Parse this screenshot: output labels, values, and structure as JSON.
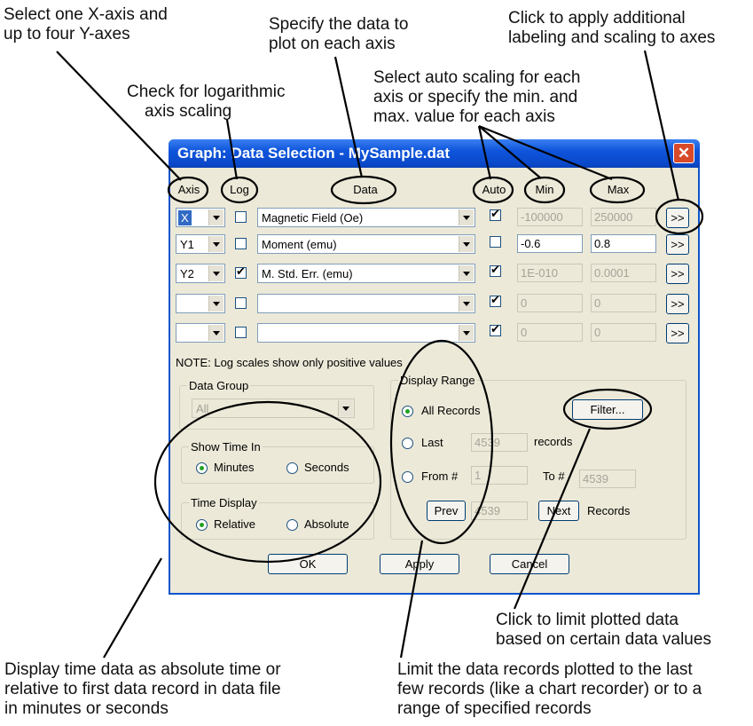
{
  "annotations": {
    "axes_select": [
      "Select one X-axis and",
      "up to four Y-axes"
    ],
    "specify_data": [
      "Specify the data to",
      "plot on each axis"
    ],
    "labeling": [
      "Click to apply additional",
      "labeling and scaling to axes"
    ],
    "log_scaling": [
      "Check for logarithmic",
      "axis scaling"
    ],
    "auto_scaling": [
      "Select auto scaling for each",
      "axis or specify the min. and",
      "max. value for each axis"
    ],
    "filter": [
      "Click to limit plotted data",
      "based on certain data values"
    ],
    "time_display": [
      "Display time data as absolute time or",
      "relative to first data record in data file",
      "in minutes or seconds"
    ],
    "limit_records": [
      "Limit the data records plotted to the last",
      "few records (like a chart recorder) or to a",
      "range of specified records"
    ]
  },
  "dialog": {
    "title": "Graph: Data Selection - MySample.dat",
    "close_glyph": "✕",
    "headers": {
      "axis": "Axis",
      "log": "Log",
      "data": "Data",
      "auto": "Auto",
      "min": "Min",
      "max": "Max"
    },
    "rows": [
      {
        "axis": "X",
        "log": false,
        "data": "Magnetic Field (Oe)",
        "auto": true,
        "min": "-100000",
        "max": "250000",
        "more": ">>"
      },
      {
        "axis": "Y1",
        "log": false,
        "data": "Moment (emu)",
        "auto": false,
        "min": "-0.6",
        "max": "0.8",
        "more": ">>"
      },
      {
        "axis": "Y2",
        "log": true,
        "data": "M. Std. Err. (emu)",
        "auto": true,
        "min": "1E-010",
        "max": "0.0001",
        "more": ">>"
      },
      {
        "axis": "",
        "log": false,
        "data": "",
        "auto": true,
        "min": "0",
        "max": "0",
        "more": ">>"
      },
      {
        "axis": "",
        "log": false,
        "data": "",
        "auto": true,
        "min": "0",
        "max": "0",
        "more": ">>"
      }
    ],
    "note": "NOTE: Log scales show only positive values",
    "data_group": {
      "label": "Data Group",
      "value": "All"
    },
    "show_time": {
      "label": "Show Time In",
      "minutes": "Minutes",
      "seconds": "Seconds",
      "selected": "minutes"
    },
    "time_display": {
      "label": "Time Display",
      "relative": "Relative",
      "absolute": "Absolute",
      "selected": "relative"
    },
    "display_range": {
      "label": "Display Range",
      "all_records": "All Records",
      "last": "Last",
      "last_value": "4539",
      "records": "records",
      "from": "From #",
      "from_value": "1",
      "to": "To #",
      "to_value": "4539",
      "prev": "Prev",
      "page_value": "4539",
      "next": "Next",
      "records_label": "Records",
      "selected": "all"
    },
    "filter_button": "Filter...",
    "buttons": {
      "ok": "OK",
      "apply": "Apply",
      "cancel": "Cancel"
    }
  }
}
